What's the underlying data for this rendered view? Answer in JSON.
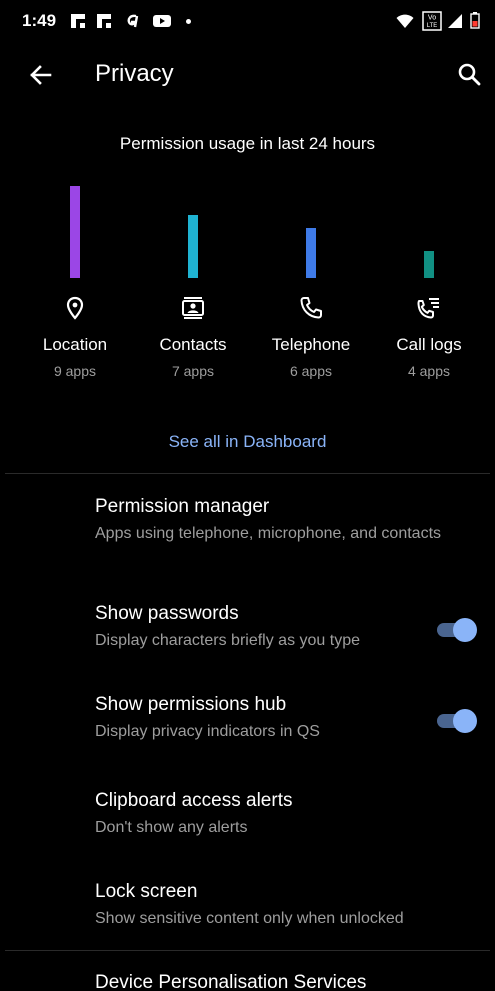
{
  "status_bar": {
    "time": "1:49",
    "left_icons": [
      "flipboard-icon",
      "flipboard-icon",
      "gpay-icon",
      "youtube-icon",
      "dot-icon"
    ],
    "right_icons": [
      "wifi-icon",
      "volte-icon",
      "signal-icon",
      "battery-icon"
    ],
    "vo_label": "Vo",
    "lte_label": "LTE",
    "battery_color": "#ff3b30"
  },
  "app_bar": {
    "title": "Privacy",
    "back_icon": "arrow-back-icon",
    "search_icon": "search-icon"
  },
  "permission_usage": {
    "title": "Permission usage in last 24 hours",
    "items": [
      {
        "label": "Location",
        "sub": "9 apps",
        "count": 9,
        "color": "#9b46e6",
        "icon": "location-pin-icon"
      },
      {
        "label": "Contacts",
        "sub": "7 apps",
        "count": 7,
        "color": "#1fb3d2",
        "icon": "contacts-icon"
      },
      {
        "label": "Telephone",
        "sub": "6 apps",
        "count": 6,
        "color": "#3f7be8",
        "icon": "phone-icon"
      },
      {
        "label": "Call logs",
        "sub": "4 apps",
        "count": 4,
        "color": "#119083",
        "icon": "call-log-icon"
      }
    ],
    "dashboard_link": "See all in Dashboard"
  },
  "settings": [
    {
      "title": "Permission manager",
      "subtitle": "Apps using telephone, microphone, and contacts"
    },
    {
      "title": "Show passwords",
      "subtitle": "Display characters briefly as you type",
      "toggle": true
    },
    {
      "title": "Show permissions hub",
      "subtitle": "Display privacy indicators in QS",
      "toggle": true
    },
    {
      "title": "Clipboard access alerts",
      "subtitle": "Don't show any alerts"
    },
    {
      "title": "Lock screen",
      "subtitle": "Show sensitive content only when unlocked"
    },
    {
      "title": "Device Personalisation Services"
    }
  ],
  "colors": {
    "background": "#000000",
    "accent": "#8ab4f8",
    "secondary_text": "#9e9e9e"
  }
}
